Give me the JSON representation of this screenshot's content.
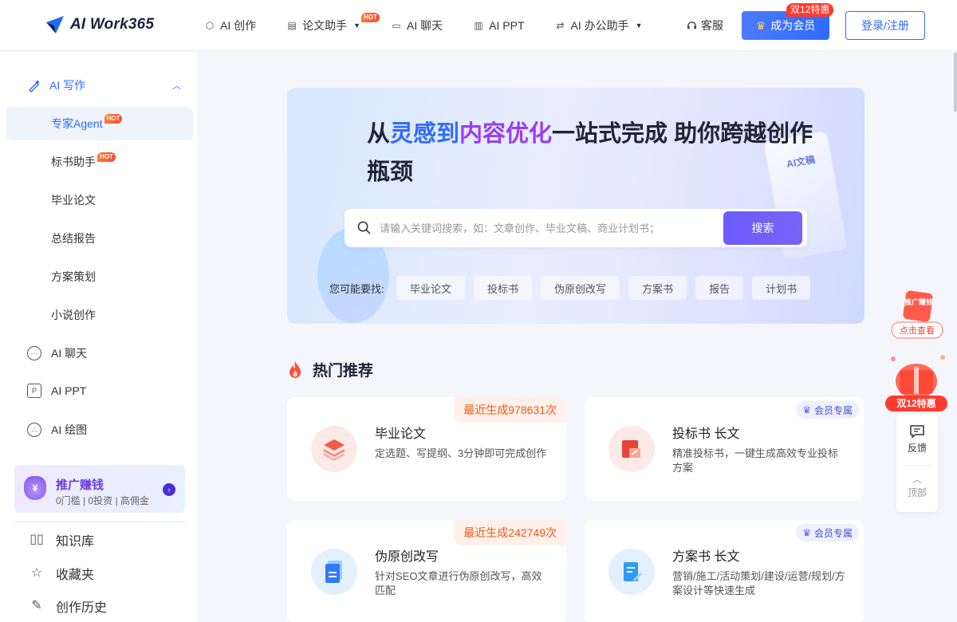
{
  "brand": {
    "name": "AI Work365"
  },
  "nav": {
    "items": [
      {
        "label": "AI 创作",
        "icon": "cube-icon"
      },
      {
        "label": "论文助手",
        "icon": "doc-icon",
        "hot": "HOT"
      },
      {
        "label": "AI 聊天",
        "icon": "chat-icon"
      },
      {
        "label": "AI PPT",
        "icon": "ppt-icon"
      },
      {
        "label": "AI 办公助手",
        "icon": "swap-icon"
      }
    ],
    "service": "客服",
    "vip_button": "成为会员",
    "vip_badge": "双12特惠",
    "login": "登录/注册"
  },
  "sidebar": {
    "group": "AI 写作",
    "sub_items": [
      {
        "label": "专家Agent",
        "hot": "HOT",
        "active": true
      },
      {
        "label": "标书助手",
        "hot": "HOT"
      },
      {
        "label": "毕业论文"
      },
      {
        "label": "总结报告"
      },
      {
        "label": "方案策划"
      },
      {
        "label": "小说创作"
      }
    ],
    "items": [
      {
        "label": "AI 聊天",
        "icon": "chat-bubble-icon"
      },
      {
        "label": "AI PPT",
        "icon": "ppt-icon"
      },
      {
        "label": "AI 绘图",
        "icon": "palette-icon"
      }
    ],
    "promo": {
      "title": "推广赚钱",
      "subtitle": "0门槛 | 0投资 | 高佣金",
      "bag_symbol": "¥"
    },
    "bottom": [
      {
        "label": "知识库",
        "icon": "book-icon"
      },
      {
        "label": "收藏夹",
        "icon": "star-icon"
      },
      {
        "label": "创作历史",
        "icon": "pen-icon"
      }
    ]
  },
  "hero": {
    "title_prefix": "从",
    "title_hl1": "灵感到",
    "title_hl2": "内容优化",
    "title_rest": "一站式完成 助你跨越创作瓶颈",
    "deco_label": "AI文稿",
    "search_placeholder": "请输入关键词搜索，如：文章创作、毕业文稿、商业计划书；",
    "search_button": "搜索",
    "suggest_label": "您可能要找:",
    "chips": [
      "毕业论文",
      "投标书",
      "伪原创改写",
      "方案书",
      "报告",
      "计划书"
    ]
  },
  "hot": {
    "title": "热门推荐",
    "cards": [
      {
        "title": "毕业论文",
        "desc": "定选题、写提纲、3分钟即可完成创作",
        "badge": "最近生成978631次",
        "badge_type": "gen",
        "icon": "layers-icon"
      },
      {
        "title": "投标书 长文",
        "desc": "精准投标书，一键生成高效专业投标方案",
        "badge": "会员专属",
        "badge_type": "vip",
        "icon": "bid-doc-icon"
      },
      {
        "title": "伪原创改写",
        "desc": "针对SEO文章进行伪原创改写，高效匹配",
        "badge": "最近生成242749次",
        "badge_type": "gen",
        "icon": "file-icon"
      },
      {
        "title": "方案书 长文",
        "desc": "营销/施工/活动策划/建设/运营/规划/方案设计等快速生成",
        "badge": "会员专属",
        "badge_type": "vip",
        "icon": "edit-doc-icon"
      }
    ]
  },
  "float": {
    "promo_text": "推广赚钱",
    "promo_button": "点击查看",
    "gift_label": "双12特惠",
    "feedback": "反馈",
    "top": "顶部"
  },
  "colors": {
    "primary": "#2f6bff",
    "purple": "#9b3cf5",
    "hot": "#ff5a2e",
    "gen_badge": "#f05a1a"
  }
}
